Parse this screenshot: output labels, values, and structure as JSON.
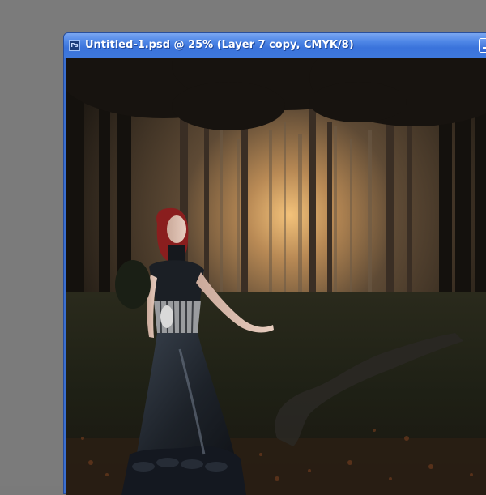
{
  "workspace": {
    "background_color": "#7b7b7b"
  },
  "document": {
    "title": "Untitled-1.psd @ 25% (Layer 7 copy, CMYK/8)",
    "app_icon": "photoshop-doc-icon",
    "app_icon_label": "Ps",
    "title_bar_color": "#3a73db"
  },
  "canvas": {
    "content": "gothic-forest-woman-image"
  }
}
